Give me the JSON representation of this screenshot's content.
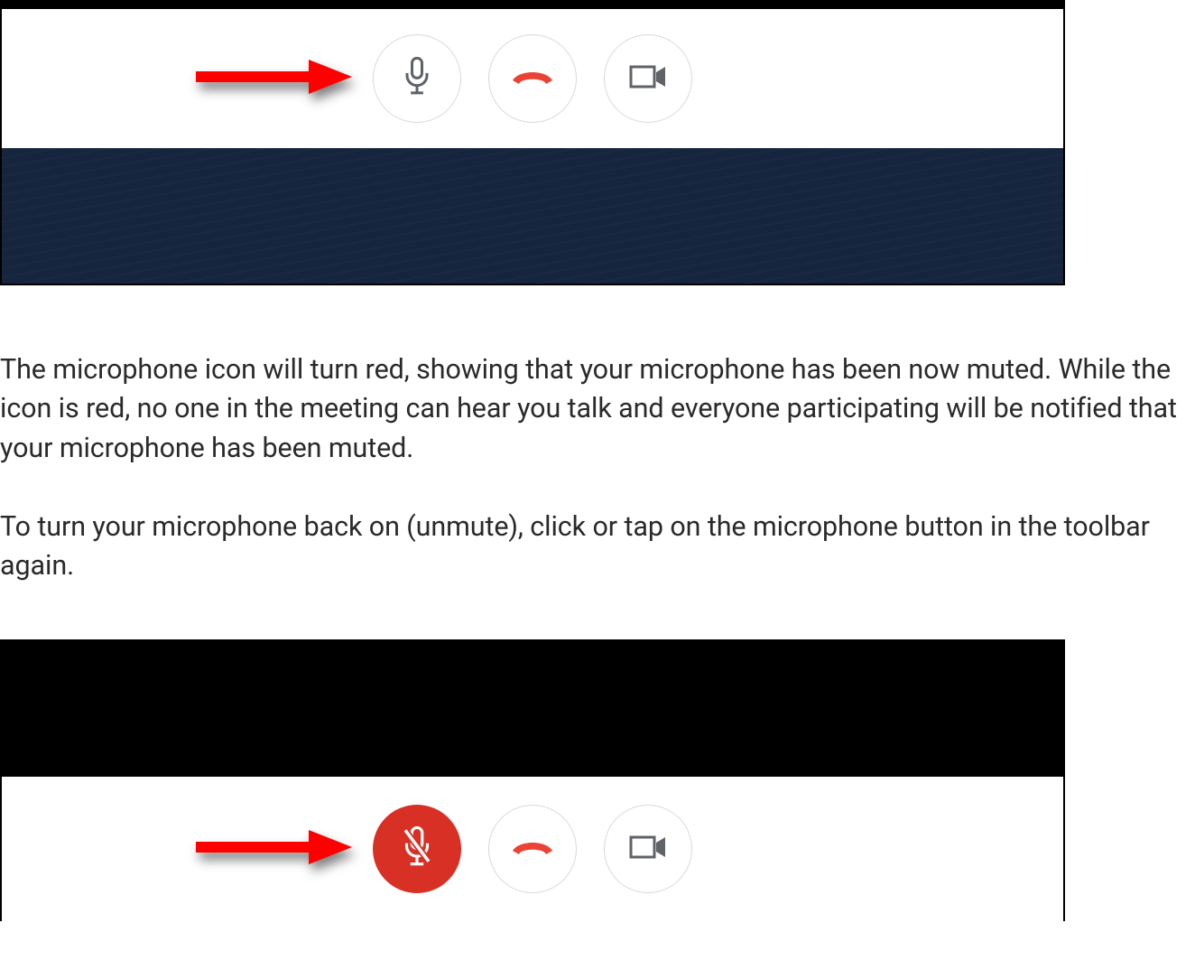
{
  "paragraphs": {
    "p1": "The microphone icon will turn red, showing that your microphone has been now muted. While the icon is red, no one in the meeting can hear you talk and everyone participating will be notified that your microphone has been muted.",
    "p2": "To turn your microphone back on (unmute), click or tap on the microphone button in the toolbar again."
  },
  "buttons": {
    "mic": "microphone",
    "hangup": "hang up",
    "camera": "camera",
    "mic_muted": "microphone muted"
  },
  "colors": {
    "accent_red": "#d93025",
    "hangup_red": "#ea4335",
    "icon_gray": "#5f6368",
    "dark_navy": "#15253d"
  }
}
